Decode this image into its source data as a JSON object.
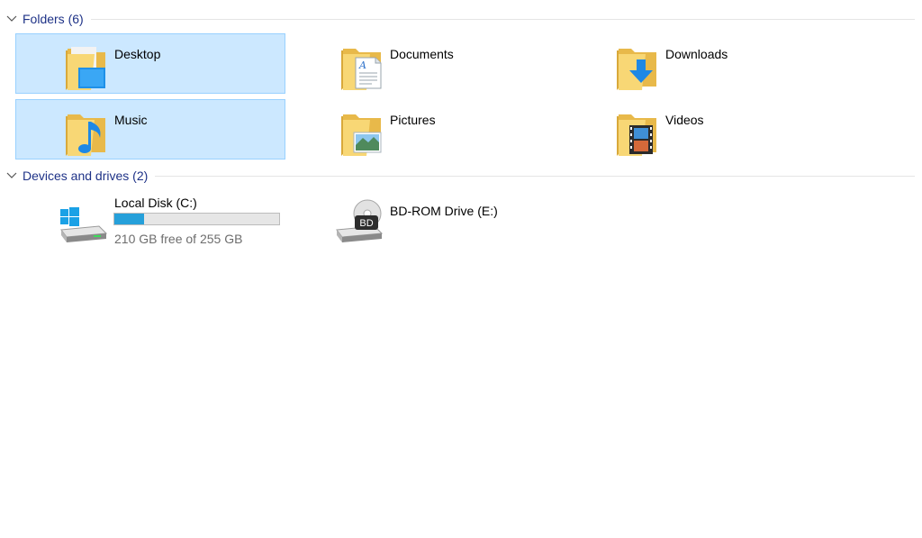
{
  "groups": {
    "folders": {
      "title": "Folders (6)",
      "items": [
        {
          "label": "Desktop",
          "icon": "desktop-folder-icon",
          "selected": true
        },
        {
          "label": "Documents",
          "icon": "documents-folder-icon",
          "selected": false
        },
        {
          "label": "Downloads",
          "icon": "downloads-folder-icon",
          "selected": false
        },
        {
          "label": "Music",
          "icon": "music-folder-icon",
          "selected": true
        },
        {
          "label": "Pictures",
          "icon": "pictures-folder-icon",
          "selected": false
        },
        {
          "label": "Videos",
          "icon": "videos-folder-icon",
          "selected": false
        }
      ]
    },
    "drives": {
      "title": "Devices and drives (2)",
      "items": [
        {
          "label": "Local Disk (C:)",
          "icon": "windows-disk-icon",
          "free_text": "210 GB free of 255 GB",
          "used_fraction": 0.18
        },
        {
          "label": "BD-ROM Drive (E:)",
          "icon": "bd-rom-drive-icon",
          "badge": "BD"
        }
      ]
    }
  },
  "colors": {
    "group_header": "#1e3287",
    "selection_bg": "#cce8ff",
    "selection_border": "#99d1ff",
    "usage_bar": "#26a0da",
    "folder_yellow": "#f8d775"
  }
}
